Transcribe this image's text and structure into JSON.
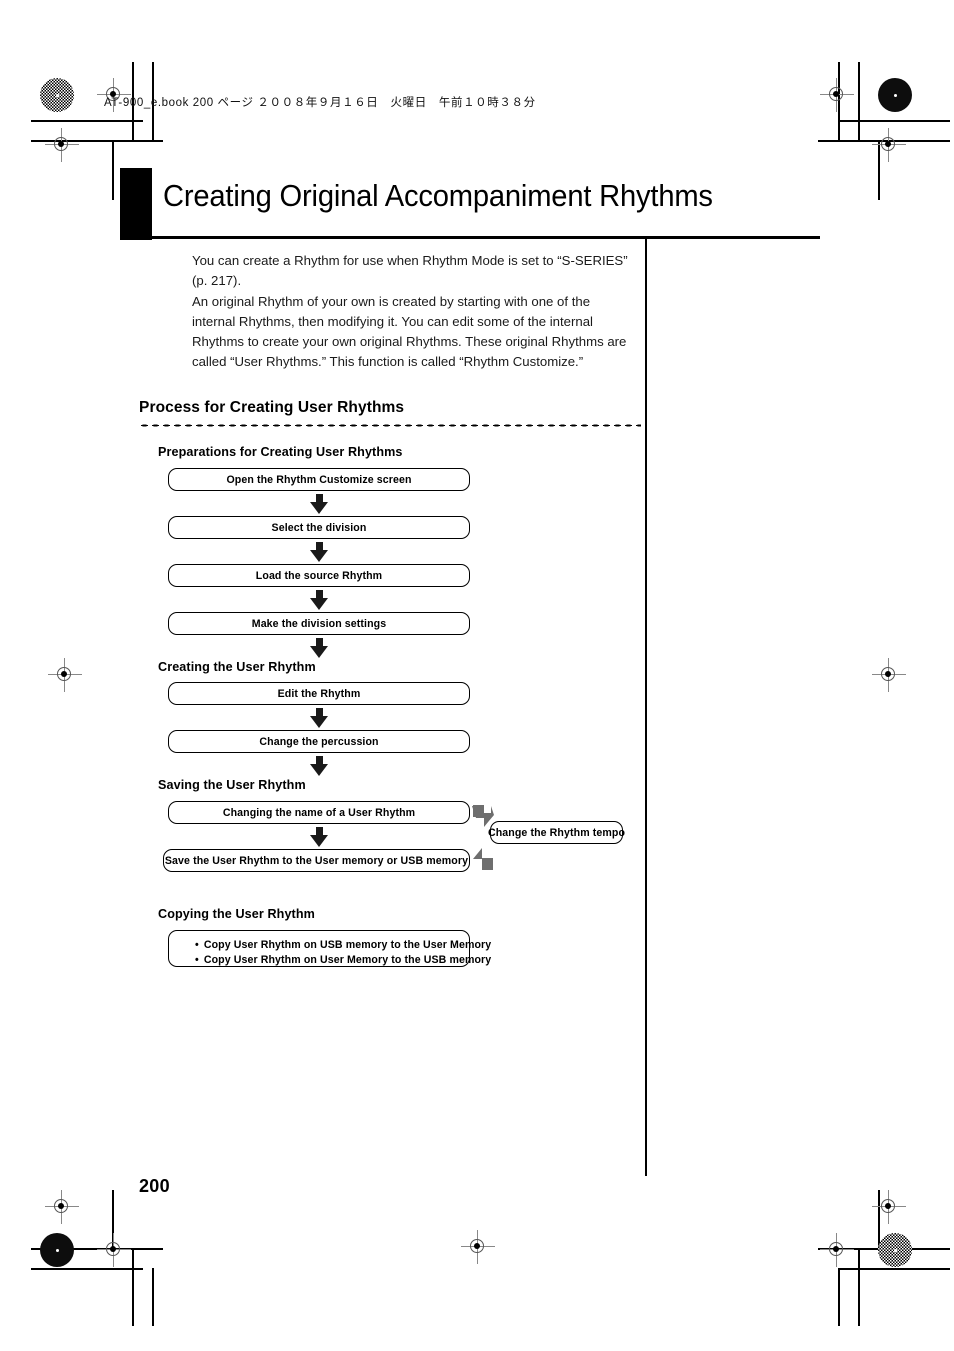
{
  "header": {
    "slug": "AT-900_e.book  200 ページ  ２００８年９月１６日　火曜日　午前１０時３８分"
  },
  "title": "Creating Original Accompaniment Rhythms",
  "intro": {
    "paragraph1": "You can create a Rhythm for use when Rhythm Mode is set to “S-SERIES” (p. 217).",
    "paragraph2": "An original Rhythm of your own is created by starting with one of the internal Rhythms, then modifying it. You can edit some of the internal Rhythms to create your own original Rhythms. These original Rhythms are called “User Rhythms.” This function is called “Rhythm Customize.”"
  },
  "section": {
    "heading": "Process for Creating User Rhythms"
  },
  "flow": {
    "group1_heading": "Preparations for Creating User Rhythms",
    "step1": "Open the Rhythm Customize screen",
    "step2": "Select the division",
    "step3": "Load the source Rhythm",
    "step4": "Make the division settings",
    "group2_heading": "Creating the User Rhythm",
    "step5": "Edit the Rhythm",
    "step6": "Change the percussion",
    "group3_heading": "Saving the User Rhythm",
    "step7": "Changing the name of a User Rhythm",
    "step8": "Save the User Rhythm to the User memory or USB memory",
    "side_box": "Change the Rhythm tempo",
    "group4_heading": "Copying the User Rhythm",
    "copy_item1": "Copy User Rhythm on USB memory to the User Memory",
    "copy_item2": "Copy User Rhythm on User Memory to the USB memory"
  },
  "footer": {
    "page_number": "200"
  },
  "colors": {
    "text": "#000000",
    "arrow_black": "#1a1a1a",
    "arrow_gray": "#6e6e6e",
    "rule": "#000000"
  }
}
